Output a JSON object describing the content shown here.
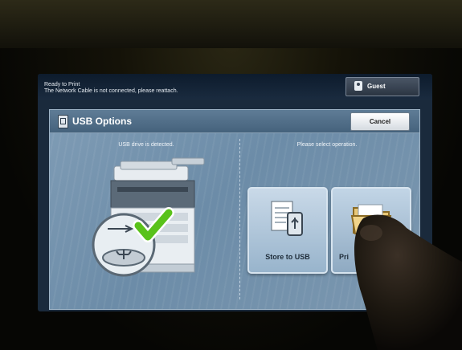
{
  "status": {
    "line1": "Ready to Print",
    "line2": "The Network Cable is not connected, please reattach."
  },
  "user": {
    "label": "Guest",
    "icon": "user-icon"
  },
  "dialog": {
    "title": "USB Options",
    "icon": "usb-drive-icon",
    "cancel_label": "Cancel",
    "left_caption": "USB drive is detected.",
    "right_caption": "Please select operation."
  },
  "operations": [
    {
      "label": "Store to USB",
      "icon": "store-to-usb-icon"
    },
    {
      "label": "Pri",
      "icon": "folder-icon"
    }
  ],
  "colors": {
    "dialog_bg": "#7f9cb5",
    "header_bg": "#45627c",
    "button_bg": "#c9d9e8",
    "checkmark": "#59c21a"
  }
}
